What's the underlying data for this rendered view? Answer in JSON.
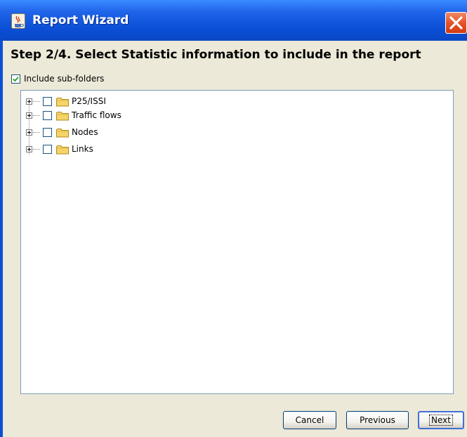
{
  "window": {
    "title": "Report Wizard",
    "icon": "java-cup-icon",
    "close_icon": "close-icon"
  },
  "wizard": {
    "step_title": "Step 2/4. Select Statistic information to include in the report"
  },
  "options": {
    "include_subfolders_label": "Include sub-folders",
    "include_subfolders_checked": true
  },
  "tree": {
    "nodes": [
      {
        "label": "P25/ISSI",
        "checked": false,
        "expanded": false
      },
      {
        "label": "Traffic flows",
        "checked": false,
        "expanded": false
      },
      {
        "label": "Nodes",
        "checked": false,
        "expanded": false
      },
      {
        "label": "Links",
        "checked": false,
        "expanded": false
      }
    ]
  },
  "buttons": {
    "cancel": "Cancel",
    "previous": "Previous",
    "next": "Next"
  },
  "colors": {
    "titlebar": "#0a4fd6",
    "client_bg": "#ece9d8",
    "close_button": "#e4542a",
    "checkbox_border": "#1c5180",
    "folder": "#f5d46b"
  }
}
